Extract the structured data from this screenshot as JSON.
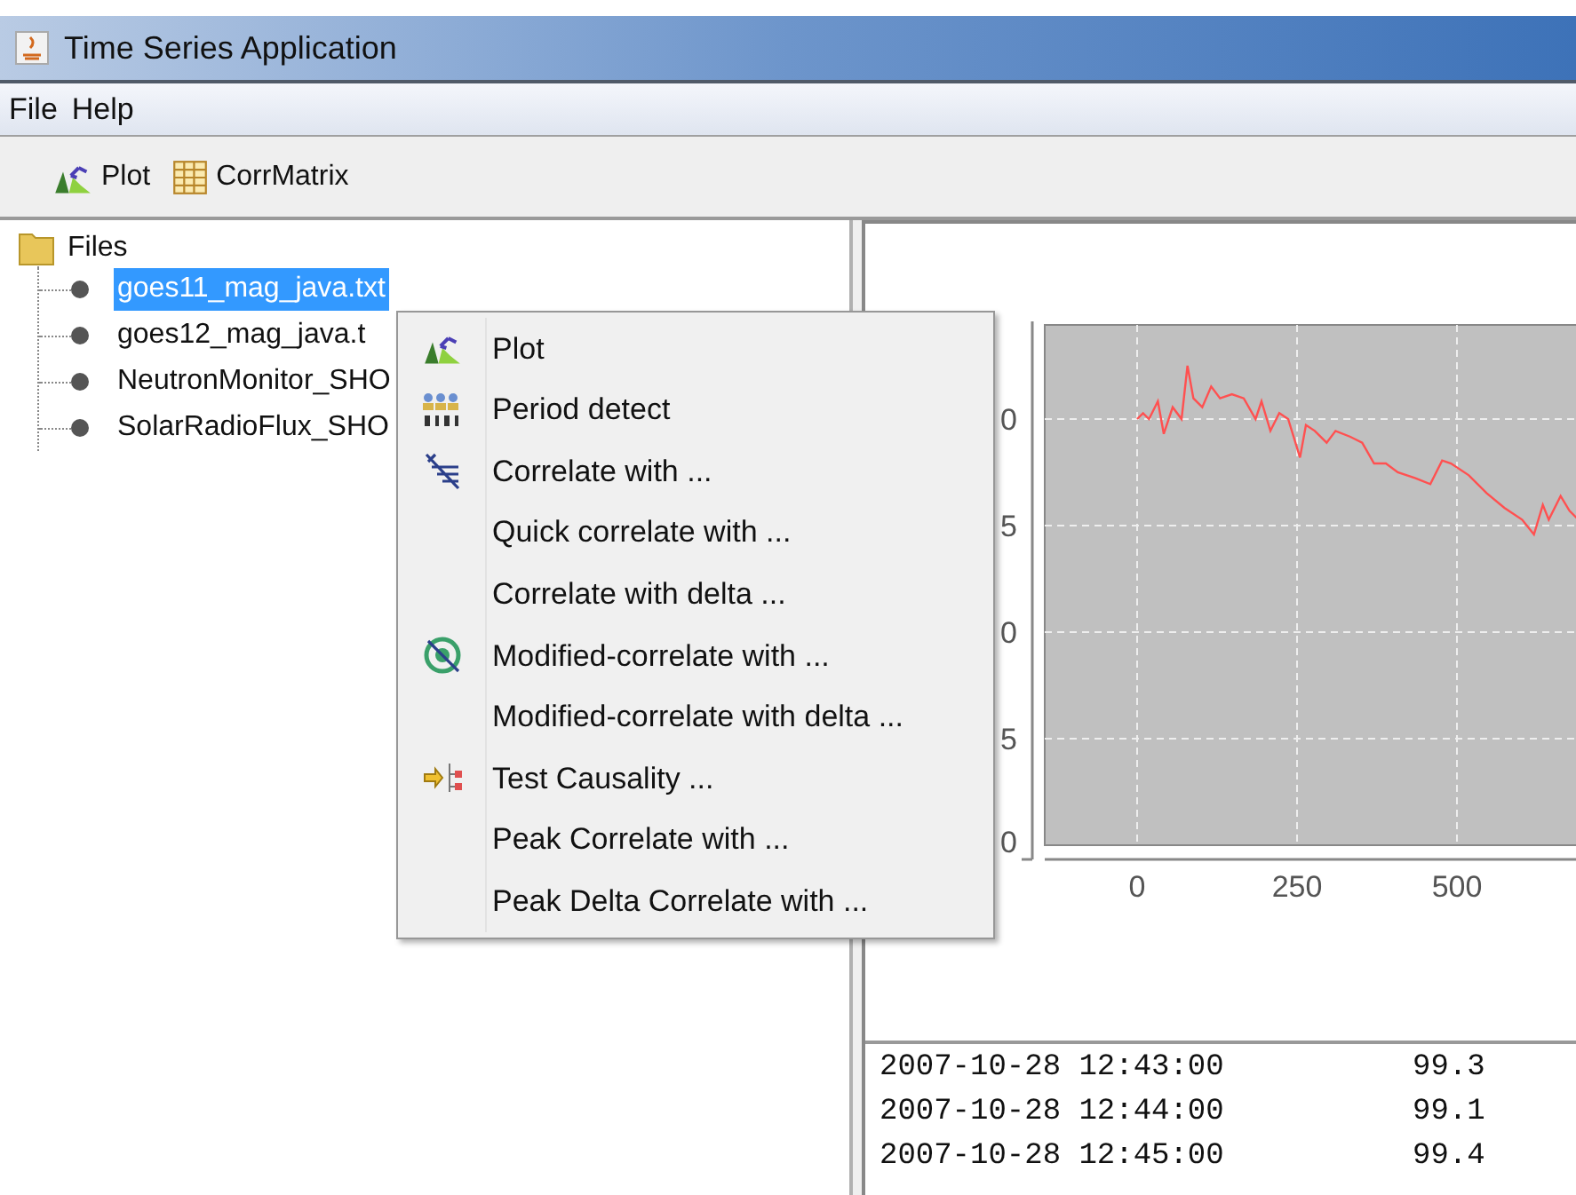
{
  "window": {
    "title": "Time Series Application"
  },
  "menu_bar": [
    "File",
    "Help"
  ],
  "toolbar": [
    {
      "kind": "plot",
      "label": "Plot"
    },
    {
      "kind": "table",
      "label": "CorrMatrix"
    }
  ],
  "tree": {
    "label": "Files",
    "expanded": true,
    "children": [
      {
        "label": "goes11_mag_java.txt",
        "selected": true
      },
      {
        "label": "goes12_mag_java.t",
        "selected": false
      },
      {
        "label": "NeutronMonitor_SHO",
        "selected": false
      },
      {
        "label": "SolarRadioFlux_SHO",
        "selected": false
      }
    ]
  },
  "context_menu": [
    {
      "label": "Plot",
      "kind": "plot"
    },
    {
      "label": "Period detect",
      "kind": "period"
    },
    {
      "label": "Correlate with ...",
      "kind": "correlate"
    },
    {
      "label": "Quick correlate with ...",
      "kind": "plain"
    },
    {
      "label": "Correlate with delta ...",
      "kind": "plain"
    },
    {
      "label": "Modified-correlate with ...",
      "kind": "modified"
    },
    {
      "label": "Modified-correlate with delta ...",
      "kind": "plain"
    },
    {
      "label": "Test Causality ...",
      "kind": "causality"
    },
    {
      "label": "Peak Correlate with ...",
      "kind": "plain"
    },
    {
      "label": "Peak Delta Correlate with ...",
      "kind": "plain"
    }
  ],
  "chart": {
    "y_tick_labels": [
      "0",
      "5",
      "0",
      "5",
      "0"
    ],
    "x_tick_labels": [
      "0",
      "250",
      "500"
    ]
  },
  "data_rows": [
    {
      "timestamp": "2007-10-28 12:43:00",
      "value": "99.3"
    },
    {
      "timestamp": "2007-10-28 12:44:00",
      "value": "99.1"
    },
    {
      "timestamp": "2007-10-28 12:45:00",
      "value": "99.4"
    }
  ]
}
